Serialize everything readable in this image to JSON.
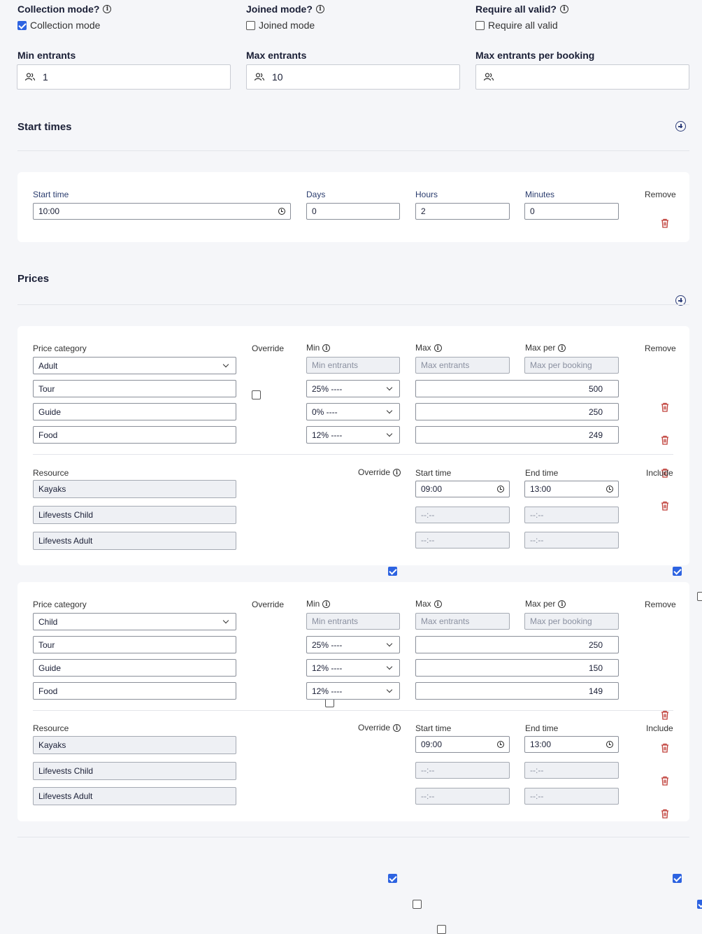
{
  "top_options": {
    "collection": {
      "heading": "Collection mode?",
      "label": "Collection mode",
      "checked": true
    },
    "joined": {
      "heading": "Joined mode?",
      "label": "Joined mode",
      "checked": false
    },
    "require_all": {
      "heading": "Require all valid?",
      "label": "Require all valid",
      "checked": false
    }
  },
  "entrants": {
    "min": {
      "label": "Min entrants",
      "value": "1"
    },
    "max": {
      "label": "Max entrants",
      "value": "10"
    },
    "max_per_booking": {
      "label": "Max entrants per booking",
      "value": ""
    }
  },
  "start_times": {
    "title": "Start times",
    "headers": {
      "start_time": "Start time",
      "days": "Days",
      "hours": "Hours",
      "minutes": "Minutes",
      "remove": "Remove"
    },
    "row": {
      "start_time": "10:00",
      "days": "0",
      "hours": "2",
      "minutes": "0"
    }
  },
  "prices": {
    "title": "Prices",
    "headers": {
      "category": "Price category",
      "override": "Override",
      "min": "Min",
      "max": "Max",
      "max_per": "Max per",
      "remove": "Remove"
    },
    "placeholders": {
      "min": "Min entrants",
      "max": "Max entrants",
      "max_per": "Max per booking"
    },
    "resource_headers": {
      "resource": "Resource",
      "override": "Override",
      "start_time": "Start time",
      "end_time": "End time",
      "include": "Include"
    },
    "empty_time": "--:--",
    "blocks": [
      {
        "category": "Adult",
        "items": [
          {
            "name": "Tour",
            "tax": "25% ----",
            "amount": "500"
          },
          {
            "name": "Guide",
            "tax": "0% ----",
            "amount": "250"
          },
          {
            "name": "Food",
            "tax": "12% ----",
            "amount": "249"
          }
        ],
        "resources": [
          {
            "name": "Kayaks",
            "override": true,
            "start": "09:00",
            "end": "13:00",
            "include": true
          },
          {
            "name": "Lifevests Child",
            "override": false,
            "start": "--:--",
            "end": "--:--",
            "include": false
          },
          {
            "name": "Lifevests Adult",
            "override": false,
            "start": "--:--",
            "end": "--:--",
            "include": true
          }
        ]
      },
      {
        "category": "Child",
        "items": [
          {
            "name": "Tour",
            "tax": "25% ----",
            "amount": "250"
          },
          {
            "name": "Guide",
            "tax": "12% ----",
            "amount": "150"
          },
          {
            "name": "Food",
            "tax": "12% ----",
            "amount": "149"
          }
        ],
        "resources": [
          {
            "name": "Kayaks",
            "override": true,
            "start": "09:00",
            "end": "13:00",
            "include": true
          },
          {
            "name": "Lifevests Child",
            "override": false,
            "start": "--:--",
            "end": "--:--",
            "include": true
          },
          {
            "name": "Lifevests Adult",
            "override": false,
            "start": "--:--",
            "end": "--:--",
            "include": false
          }
        ]
      }
    ]
  },
  "colors": {
    "accent": "#2d63e1",
    "danger": "#c0403a",
    "background": "#f5f6f9"
  }
}
